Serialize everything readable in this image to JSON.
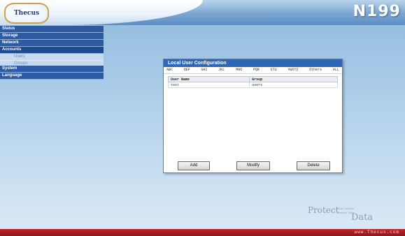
{
  "header": {
    "logo_text": "Thecus",
    "model": "N199"
  },
  "sidebar": {
    "items": [
      {
        "label": "Status"
      },
      {
        "label": "Storage"
      },
      {
        "label": "Network"
      },
      {
        "label": "Accounts"
      },
      {
        "label": "Users",
        "sub": true
      },
      {
        "label": "Groups",
        "sub": true
      },
      {
        "label": "System"
      },
      {
        "label": "Language"
      }
    ]
  },
  "panel": {
    "title": "Local User Configuration",
    "filters": [
      "ABC",
      "DEF",
      "GHI",
      "JKL",
      "MNO",
      "PQR",
      "STU",
      "VWXYZ",
      "Others",
      "ALL"
    ],
    "table": {
      "headers": [
        "User Name",
        "Group"
      ],
      "rows": [
        [
          "test",
          "users"
        ]
      ]
    },
    "buttons": {
      "add": "Add",
      "modify": "Modify",
      "delete": "Delete"
    }
  },
  "tagline": {
    "word1": "Protect",
    "small1": "Your Server",
    "small2": "Secure Your",
    "word2": "Data"
  },
  "footer": {
    "url": "www.Thecus.com"
  },
  "colors": {
    "nav_bg": "#2c5aa3",
    "panel_title_bg": "#2f67b7",
    "footer_bg": "#c0262b"
  }
}
